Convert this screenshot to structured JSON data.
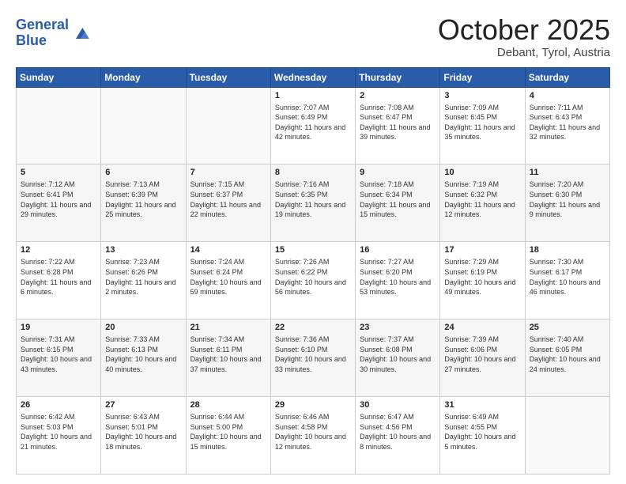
{
  "header": {
    "logo_general": "General",
    "logo_blue": "Blue",
    "month": "October 2025",
    "location": "Debant, Tyrol, Austria"
  },
  "weekdays": [
    "Sunday",
    "Monday",
    "Tuesday",
    "Wednesday",
    "Thursday",
    "Friday",
    "Saturday"
  ],
  "weeks": [
    [
      {
        "day": "",
        "sunrise": "",
        "sunset": "",
        "daylight": ""
      },
      {
        "day": "",
        "sunrise": "",
        "sunset": "",
        "daylight": ""
      },
      {
        "day": "",
        "sunrise": "",
        "sunset": "",
        "daylight": ""
      },
      {
        "day": "1",
        "sunrise": "Sunrise: 7:07 AM",
        "sunset": "Sunset: 6:49 PM",
        "daylight": "Daylight: 11 hours and 42 minutes."
      },
      {
        "day": "2",
        "sunrise": "Sunrise: 7:08 AM",
        "sunset": "Sunset: 6:47 PM",
        "daylight": "Daylight: 11 hours and 39 minutes."
      },
      {
        "day": "3",
        "sunrise": "Sunrise: 7:09 AM",
        "sunset": "Sunset: 6:45 PM",
        "daylight": "Daylight: 11 hours and 35 minutes."
      },
      {
        "day": "4",
        "sunrise": "Sunrise: 7:11 AM",
        "sunset": "Sunset: 6:43 PM",
        "daylight": "Daylight: 11 hours and 32 minutes."
      }
    ],
    [
      {
        "day": "5",
        "sunrise": "Sunrise: 7:12 AM",
        "sunset": "Sunset: 6:41 PM",
        "daylight": "Daylight: 11 hours and 29 minutes."
      },
      {
        "day": "6",
        "sunrise": "Sunrise: 7:13 AM",
        "sunset": "Sunset: 6:39 PM",
        "daylight": "Daylight: 11 hours and 25 minutes."
      },
      {
        "day": "7",
        "sunrise": "Sunrise: 7:15 AM",
        "sunset": "Sunset: 6:37 PM",
        "daylight": "Daylight: 11 hours and 22 minutes."
      },
      {
        "day": "8",
        "sunrise": "Sunrise: 7:16 AM",
        "sunset": "Sunset: 6:35 PM",
        "daylight": "Daylight: 11 hours and 19 minutes."
      },
      {
        "day": "9",
        "sunrise": "Sunrise: 7:18 AM",
        "sunset": "Sunset: 6:34 PM",
        "daylight": "Daylight: 11 hours and 15 minutes."
      },
      {
        "day": "10",
        "sunrise": "Sunrise: 7:19 AM",
        "sunset": "Sunset: 6:32 PM",
        "daylight": "Daylight: 11 hours and 12 minutes."
      },
      {
        "day": "11",
        "sunrise": "Sunrise: 7:20 AM",
        "sunset": "Sunset: 6:30 PM",
        "daylight": "Daylight: 11 hours and 9 minutes."
      }
    ],
    [
      {
        "day": "12",
        "sunrise": "Sunrise: 7:22 AM",
        "sunset": "Sunset: 6:28 PM",
        "daylight": "Daylight: 11 hours and 6 minutes."
      },
      {
        "day": "13",
        "sunrise": "Sunrise: 7:23 AM",
        "sunset": "Sunset: 6:26 PM",
        "daylight": "Daylight: 11 hours and 2 minutes."
      },
      {
        "day": "14",
        "sunrise": "Sunrise: 7:24 AM",
        "sunset": "Sunset: 6:24 PM",
        "daylight": "Daylight: 10 hours and 59 minutes."
      },
      {
        "day": "15",
        "sunrise": "Sunrise: 7:26 AM",
        "sunset": "Sunset: 6:22 PM",
        "daylight": "Daylight: 10 hours and 56 minutes."
      },
      {
        "day": "16",
        "sunrise": "Sunrise: 7:27 AM",
        "sunset": "Sunset: 6:20 PM",
        "daylight": "Daylight: 10 hours and 53 minutes."
      },
      {
        "day": "17",
        "sunrise": "Sunrise: 7:29 AM",
        "sunset": "Sunset: 6:19 PM",
        "daylight": "Daylight: 10 hours and 49 minutes."
      },
      {
        "day": "18",
        "sunrise": "Sunrise: 7:30 AM",
        "sunset": "Sunset: 6:17 PM",
        "daylight": "Daylight: 10 hours and 46 minutes."
      }
    ],
    [
      {
        "day": "19",
        "sunrise": "Sunrise: 7:31 AM",
        "sunset": "Sunset: 6:15 PM",
        "daylight": "Daylight: 10 hours and 43 minutes."
      },
      {
        "day": "20",
        "sunrise": "Sunrise: 7:33 AM",
        "sunset": "Sunset: 6:13 PM",
        "daylight": "Daylight: 10 hours and 40 minutes."
      },
      {
        "day": "21",
        "sunrise": "Sunrise: 7:34 AM",
        "sunset": "Sunset: 6:11 PM",
        "daylight": "Daylight: 10 hours and 37 minutes."
      },
      {
        "day": "22",
        "sunrise": "Sunrise: 7:36 AM",
        "sunset": "Sunset: 6:10 PM",
        "daylight": "Daylight: 10 hours and 33 minutes."
      },
      {
        "day": "23",
        "sunrise": "Sunrise: 7:37 AM",
        "sunset": "Sunset: 6:08 PM",
        "daylight": "Daylight: 10 hours and 30 minutes."
      },
      {
        "day": "24",
        "sunrise": "Sunrise: 7:39 AM",
        "sunset": "Sunset: 6:06 PM",
        "daylight": "Daylight: 10 hours and 27 minutes."
      },
      {
        "day": "25",
        "sunrise": "Sunrise: 7:40 AM",
        "sunset": "Sunset: 6:05 PM",
        "daylight": "Daylight: 10 hours and 24 minutes."
      }
    ],
    [
      {
        "day": "26",
        "sunrise": "Sunrise: 6:42 AM",
        "sunset": "Sunset: 5:03 PM",
        "daylight": "Daylight: 10 hours and 21 minutes."
      },
      {
        "day": "27",
        "sunrise": "Sunrise: 6:43 AM",
        "sunset": "Sunset: 5:01 PM",
        "daylight": "Daylight: 10 hours and 18 minutes."
      },
      {
        "day": "28",
        "sunrise": "Sunrise: 6:44 AM",
        "sunset": "Sunset: 5:00 PM",
        "daylight": "Daylight: 10 hours and 15 minutes."
      },
      {
        "day": "29",
        "sunrise": "Sunrise: 6:46 AM",
        "sunset": "Sunset: 4:58 PM",
        "daylight": "Daylight: 10 hours and 12 minutes."
      },
      {
        "day": "30",
        "sunrise": "Sunrise: 6:47 AM",
        "sunset": "Sunset: 4:56 PM",
        "daylight": "Daylight: 10 hours and 8 minutes."
      },
      {
        "day": "31",
        "sunrise": "Sunrise: 6:49 AM",
        "sunset": "Sunset: 4:55 PM",
        "daylight": "Daylight: 10 hours and 5 minutes."
      },
      {
        "day": "",
        "sunrise": "",
        "sunset": "",
        "daylight": ""
      }
    ]
  ]
}
